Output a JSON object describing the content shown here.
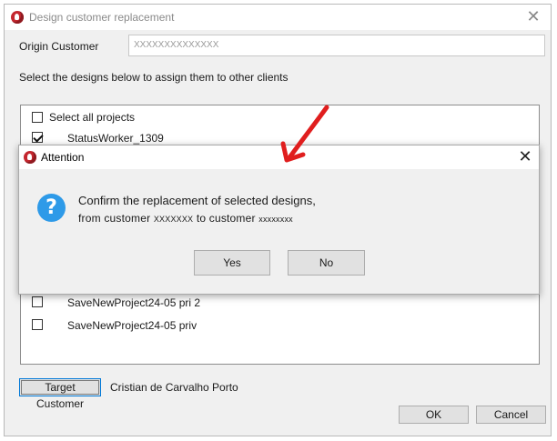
{
  "main_window": {
    "title": "Design customer replacement",
    "close_glyph": "✕",
    "origin_label": "Origin Customer",
    "origin_value": "XXXXXXXXXXXXXX",
    "instructions": "Select the designs below to assign them to other clients",
    "select_all_label": "Select all projects",
    "items": [
      {
        "label": "StatusWorker_1309",
        "checked": true
      },
      {
        "label": "SaveNewProject24-05 pri 2",
        "checked": false
      },
      {
        "label": "SaveNewProject24-05 priv",
        "checked": false
      }
    ],
    "target_button_label": "Target Customer",
    "target_value": "Cristian de Carvalho Porto",
    "ok_label": "OK",
    "cancel_label": "Cancel"
  },
  "dialog": {
    "title": "Attention",
    "close_glyph": "✕",
    "icon_glyph": "?",
    "message_line1": "Confirm the replacement of selected designs,",
    "msg2_prefix": "from customer",
    "msg2_source": "XXXXXXX",
    "msg2_middle": "to customer",
    "msg2_target": "xxxxxxxx",
    "yes_label": "Yes",
    "no_label": "No"
  },
  "colors": {
    "arrow": "#e01e1e",
    "question_icon": "#2e9ae8",
    "brand_icon": "#c4262e"
  },
  "icons": [
    "app-logo-icon",
    "close-icon",
    "question-icon",
    "red-arrow-annotation"
  ]
}
